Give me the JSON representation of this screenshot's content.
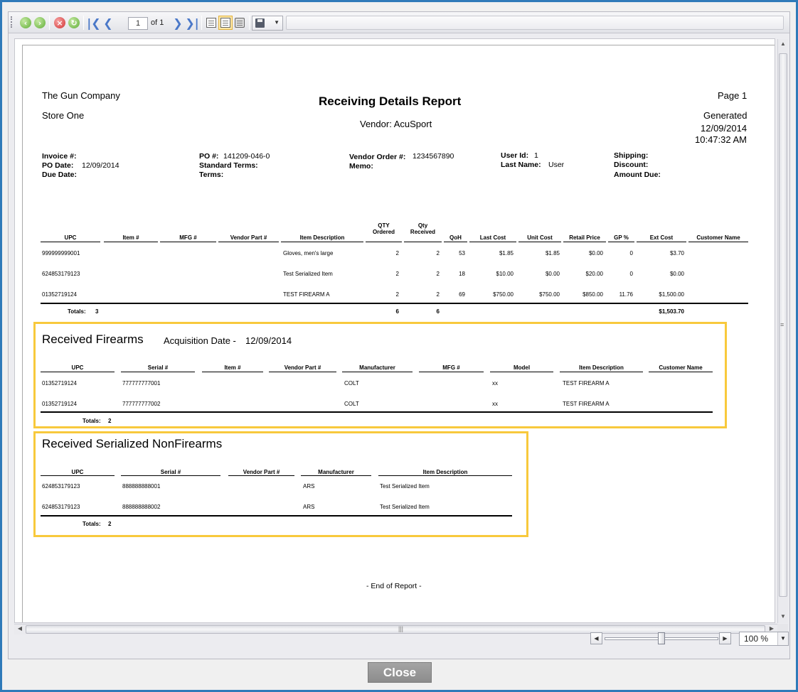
{
  "toolbar": {
    "page_current": "1",
    "page_of": "of 1"
  },
  "report": {
    "company": "The Gun Company",
    "store": "Store One",
    "title": "Receiving Details Report",
    "vendor": "Vendor: AcuSport",
    "page": "Page 1",
    "generated_label": "Generated",
    "generated_date": "12/09/2014",
    "generated_time": "10:47:32 AM",
    "invoice_label": "Invoice #:",
    "po_date_label": "PO Date:",
    "po_date_value": "12/09/2014",
    "due_date_label": "Due Date:",
    "po_label": "PO #:",
    "po_value": "141209-046-0",
    "standard_terms_label": "Standard Terms:",
    "terms_label": "Terms:",
    "vendor_order_label": "Vendor Order #:",
    "vendor_order_value": "1234567890",
    "memo_label": "Memo:",
    "user_id_label": "User Id:",
    "user_id_value": "1",
    "last_name_label": "Last Name:",
    "last_name_value": "User",
    "shipping_label": "Shipping:",
    "discount_label": "Discount:",
    "amount_due_label": "Amount Due:",
    "end": "- End of Report -"
  },
  "main_table": {
    "headers": [
      "UPC",
      "Item #",
      "MFG #",
      "Vendor Part #",
      "Item Description",
      "QTY",
      "Ordered",
      "Qty",
      "Received",
      "QoH",
      "Last Cost",
      "Unit Cost",
      "Retail Price",
      "GP %",
      "Ext Cost",
      "Customer Name"
    ],
    "rows": [
      {
        "upc": "999999999001",
        "desc": "Gloves, men's large",
        "qty_ordered": "2",
        "qty_received": "2",
        "qoh": "53",
        "last_cost": "$1.85",
        "unit_cost": "$1.85",
        "retail": "$0.00",
        "gp": "0",
        "ext": "$3.70"
      },
      {
        "upc": "624853179123",
        "desc": "Test Serialized Item",
        "qty_ordered": "2",
        "qty_received": "2",
        "qoh": "18",
        "last_cost": "$10.00",
        "unit_cost": "$0.00",
        "retail": "$20.00",
        "gp": "0",
        "ext": "$0.00"
      },
      {
        "upc": "01352719124",
        "desc": "TEST FIREARM A",
        "qty_ordered": "2",
        "qty_received": "2",
        "qoh": "69",
        "last_cost": "$750.00",
        "unit_cost": "$750.00",
        "retail": "$850.00",
        "gp": "11.76",
        "ext": "$1,500.00"
      }
    ],
    "totals_label": "Totals:",
    "totals_count": "3",
    "totals_ordered": "6",
    "totals_received": "6",
    "totals_ext": "$1,503.70"
  },
  "firearms": {
    "title": "Received Firearms",
    "acq_label": "Acquisition Date -",
    "acq_date": "12/09/2014",
    "headers": [
      "UPC",
      "Serial #",
      "Item #",
      "Vendor Part #",
      "Manufacturer",
      "MFG #",
      "Model",
      "Item Description",
      "Customer Name"
    ],
    "rows": [
      {
        "upc": "01352719124",
        "serial": "777777777001",
        "mfr": "COLT",
        "model": "xx",
        "desc": "TEST FIREARM A"
      },
      {
        "upc": "01352719124",
        "serial": "777777777002",
        "mfr": "COLT",
        "model": "xx",
        "desc": "TEST FIREARM A"
      }
    ],
    "totals_label": "Totals:",
    "totals_count": "2"
  },
  "nonfirearms": {
    "title": "Received Serialized NonFirearms",
    "headers": [
      "UPC",
      "Serial #",
      "Vendor Part #",
      "Manufacturer",
      "Item Description"
    ],
    "rows": [
      {
        "upc": "624853179123",
        "serial": "888888888001",
        "mfr": "ARS",
        "desc": "Test Serialized Item"
      },
      {
        "upc": "624853179123",
        "serial": "888888888002",
        "mfr": "ARS",
        "desc": "Test Serialized Item"
      }
    ],
    "totals_label": "Totals:",
    "totals_count": "2"
  },
  "zoom": {
    "value": "100 %"
  },
  "footer": {
    "close_label": "Close"
  },
  "colors": {
    "frame": "#2f7ab9",
    "highlight": "#f8c93c",
    "close_button": "#999999"
  },
  "icons": [
    "back-icon",
    "forward-icon",
    "stop-icon",
    "refresh-icon",
    "first-page-icon",
    "prev-page-icon",
    "next-page-icon",
    "last-page-icon",
    "page-layout-icon",
    "print-layout-icon",
    "print-icon",
    "save-icon"
  ]
}
